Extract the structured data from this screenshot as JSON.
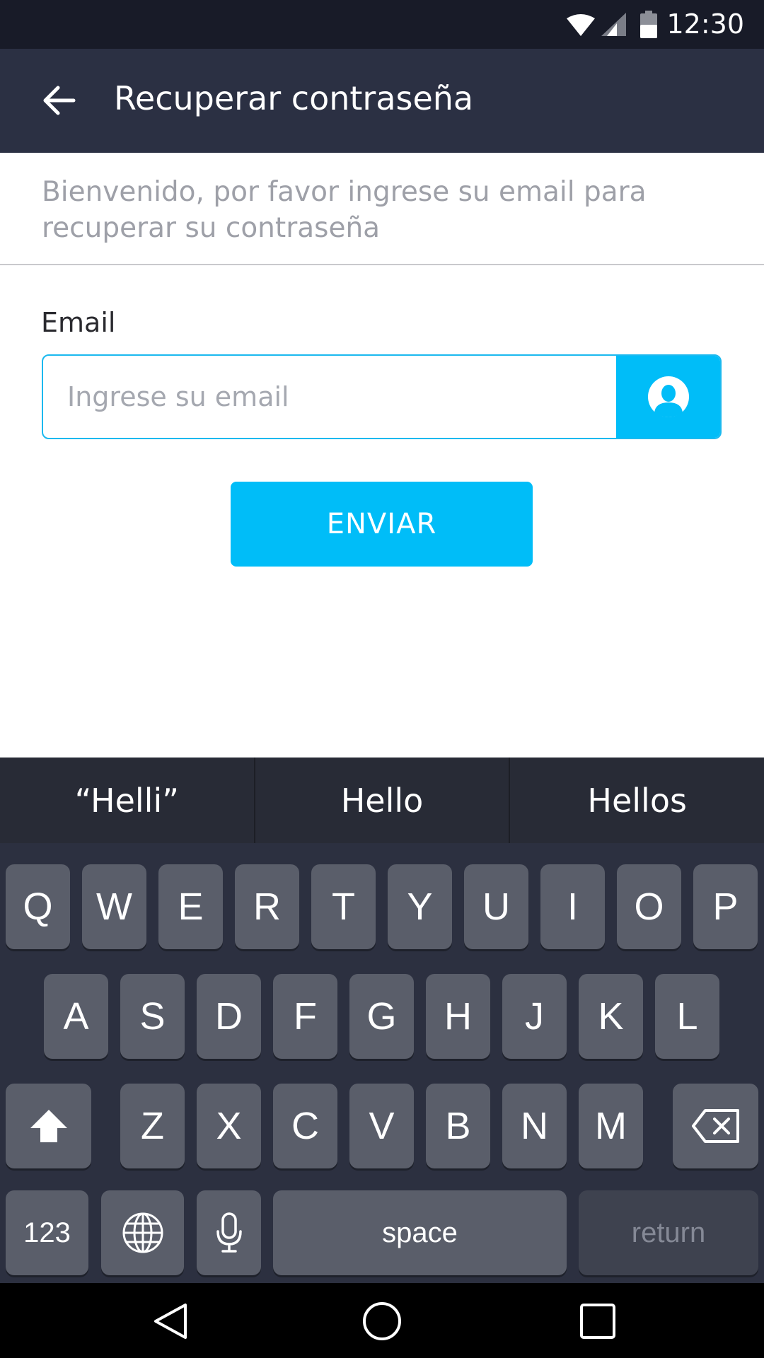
{
  "status_bar": {
    "time": "12:30"
  },
  "app_bar": {
    "title": "Recuperar contraseña",
    "back_icon": "arrow-back-icon"
  },
  "welcome": {
    "text": "Bienvenido, por favor ingrese su email para recuperar su contraseña"
  },
  "form": {
    "email_label": "Email",
    "email_placeholder": "Ingrese su email",
    "email_value": "",
    "email_icon": "person-icon",
    "send_label": "ENVIAR"
  },
  "suggestions": [
    "“Helli”",
    "Hello",
    "Hellos"
  ],
  "keyboard": {
    "row1": [
      "Q",
      "W",
      "E",
      "R",
      "T",
      "Y",
      "U",
      "I",
      "O",
      "P"
    ],
    "row2": [
      "A",
      "S",
      "D",
      "F",
      "G",
      "H",
      "J",
      "K",
      "L"
    ],
    "row3": [
      "Z",
      "X",
      "C",
      "V",
      "B",
      "N",
      "M"
    ],
    "numbers_label": "123",
    "space_label": "space",
    "return_label": "return"
  },
  "colors": {
    "accent": "#00bdf8",
    "app_bar": "#2b3043",
    "status_bar": "#181b28",
    "keyboard": "#2c3040"
  }
}
